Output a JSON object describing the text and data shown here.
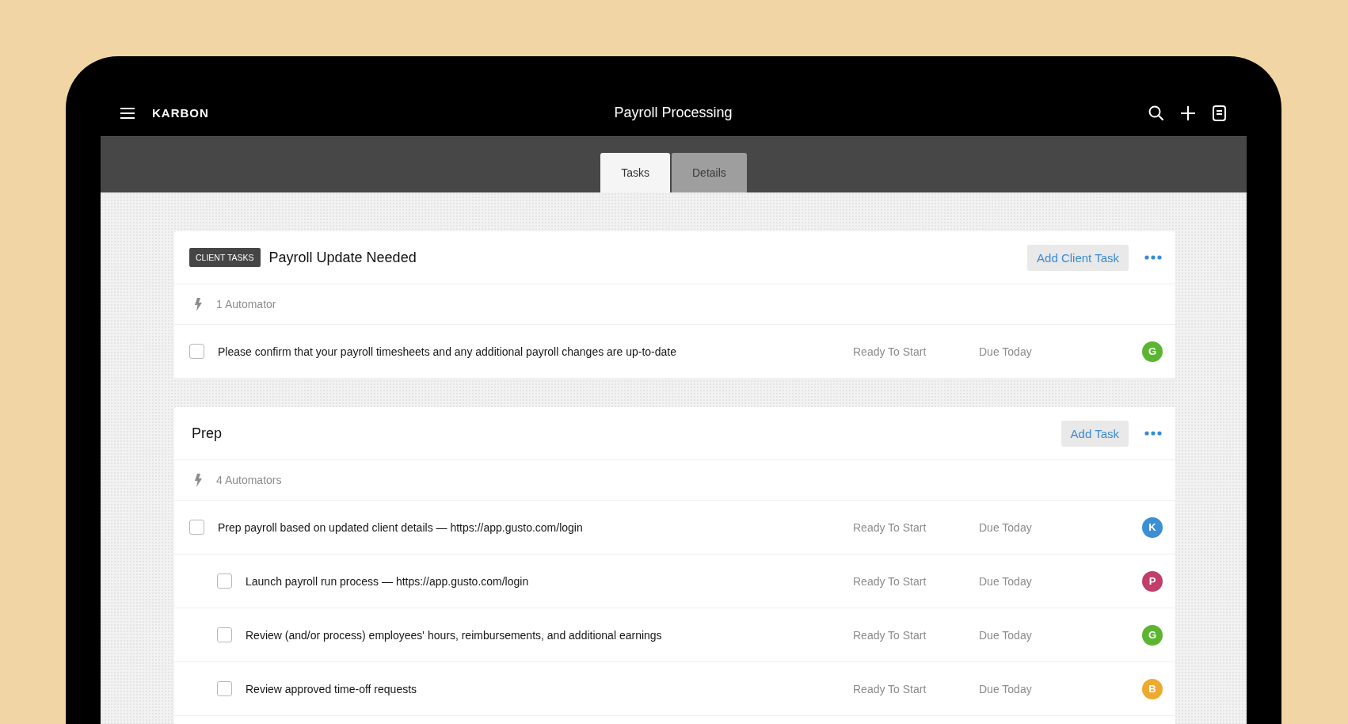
{
  "header": {
    "brand": "KARBON",
    "title": "Payroll Processing"
  },
  "tabs": [
    {
      "label": "Tasks",
      "selected": true
    },
    {
      "label": "Details",
      "selected": false
    }
  ],
  "sections": [
    {
      "tag": "CLIENT TASKS",
      "title": "Payroll Update Needed",
      "add_button": "Add Client Task",
      "automators": "1 Automator",
      "tasks": [
        {
          "text": "Please confirm that your payroll timesheets and any additional payroll changes are up-to-date",
          "checked": false,
          "status": "Ready To Start",
          "due": "Due Today",
          "assignee": "G",
          "color": "#5cb531"
        }
      ]
    },
    {
      "title": "Prep",
      "add_button": "Add Task",
      "automators": "4 Automators",
      "tasks": [
        {
          "text": "Prep payroll based on updated client details — https://app.gusto.com/login",
          "checked": false,
          "status": "Ready To Start",
          "due": "Due Today",
          "assignee": "K",
          "color": "#3b8fd5",
          "children": [
            {
              "text": "Launch payroll run process — https://app.gusto.com/login",
              "checked": false,
              "status": "Ready To Start",
              "due": "Due Today",
              "assignee": "P",
              "color": "#c13d6a"
            },
            {
              "text": "Review (and/or process) employees' hours, reimbursements, and additional earnings",
              "checked": false,
              "status": "Ready To Start",
              "due": "Due Today",
              "assignee": "G",
              "color": "#5cb531"
            },
            {
              "text": "Review approved time-off requests",
              "checked": false,
              "status": "Ready To Start",
              "due": "Due Today",
              "assignee": "B",
              "color": "#eeaa30"
            }
          ]
        }
      ]
    }
  ]
}
